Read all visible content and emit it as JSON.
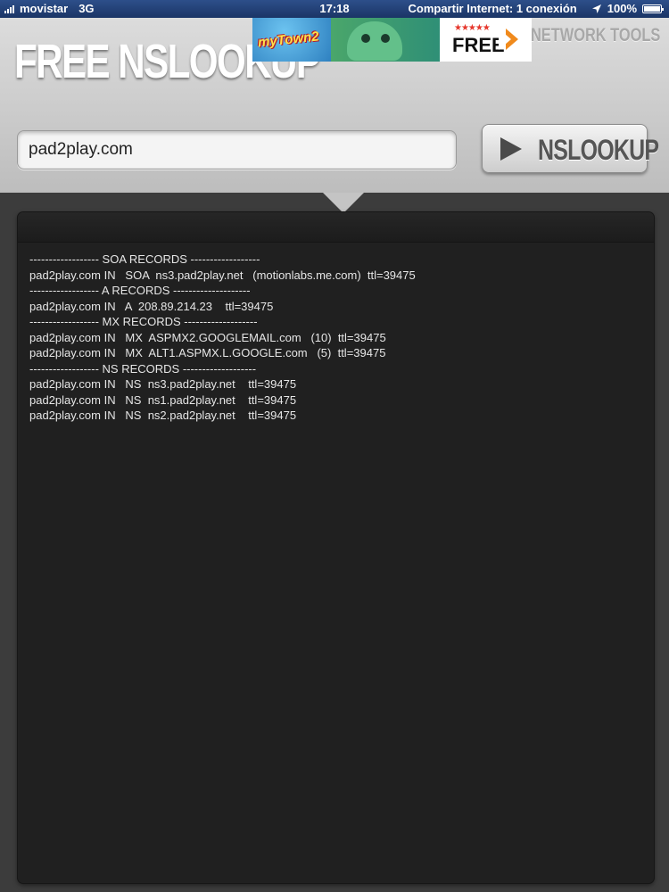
{
  "status_bar": {
    "carrier": "movistar",
    "network": "3G",
    "time": "17:18",
    "sharing": "Compartir Internet: 1 conexión",
    "battery": "100%",
    "icons": [
      "signal-icon",
      "location-arrow-icon",
      "battery-icon"
    ]
  },
  "header": {
    "app_title": "FREE NSLOOKUP",
    "section_label": "NETWORK TOOLS",
    "ad": {
      "brand": "myTown2",
      "cta": "FREE",
      "stars": "★★★★★"
    }
  },
  "lookup": {
    "domain_value": "pad2play.com",
    "button_label": "NSLOOKUP",
    "button_icon": "play-icon"
  },
  "results": {
    "lines": [
      "------------------ SOA RECORDS ------------------",
      "pad2play.com IN   SOA  ns3.pad2play.net   (motionlabs.me.com)  ttl=39475",
      "------------------ A RECORDS --------------------",
      "pad2play.com IN   A  208.89.214.23    ttl=39475",
      "------------------ MX RECORDS -------------------",
      "pad2play.com IN   MX  ASPMX2.GOOGLEMAIL.com   (10)  ttl=39475",
      "pad2play.com IN   MX  ALT1.ASPMX.L.GOOGLE.com   (5)  ttl=39475",
      "------------------ NS RECORDS -------------------",
      "pad2play.com IN   NS  ns3.pad2play.net    ttl=39475",
      "pad2play.com IN   NS  ns1.pad2play.net    ttl=39475",
      "pad2play.com IN   NS  ns2.pad2play.net    ttl=39475"
    ]
  },
  "colors": {
    "status_bar": "#1b3566",
    "header_bg": "#cfcfcf",
    "panel_bg": "#202020",
    "result_text": "#e6e6e6"
  }
}
